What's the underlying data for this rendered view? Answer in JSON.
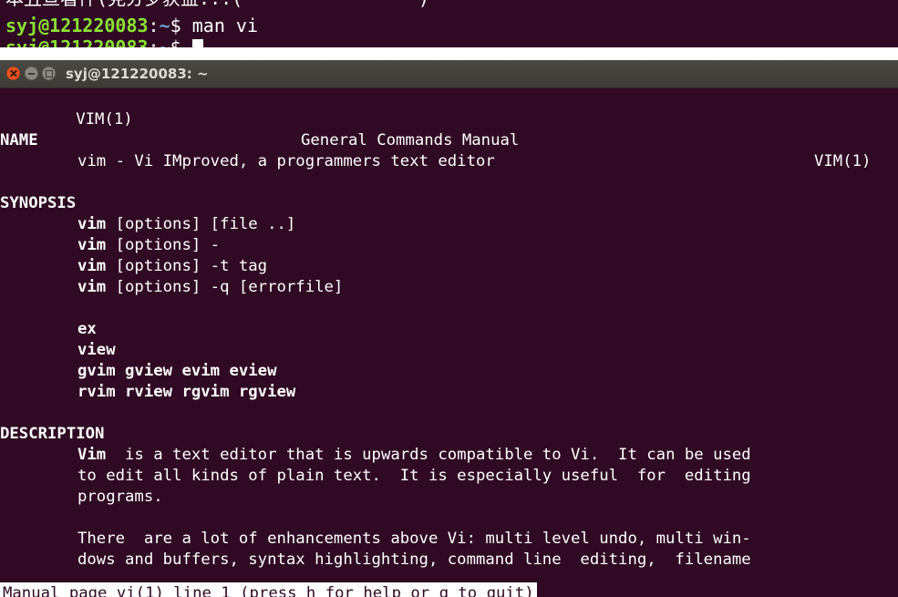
{
  "background_terminal": {
    "cropped_line": "本丑亘看件(見分岁获益...(                )",
    "prompt_user_host": "syj@121220083",
    "prompt_sep": ":",
    "prompt_path": "~",
    "prompt_symbol": "$",
    "command": "man vi",
    "next_prompt_user_host": "syj@121220083",
    "next_prompt_sep": ":",
    "next_prompt_path": "~",
    "next_prompt_symbol": "$"
  },
  "window": {
    "title": "syj@121220083: ~",
    "buttons": {
      "close": "close",
      "minimize": "minimize",
      "maximize": "maximize"
    }
  },
  "manpage": {
    "header_left": "VIM(1)",
    "header_center": "General Commands Manual",
    "header_right": "VIM(1)",
    "name_heading": "NAME",
    "name_text": "vim - Vi IMproved, a programmers text editor",
    "synopsis_heading": "SYNOPSIS",
    "synopsis_cmd": "vim",
    "synopsis": [
      " [options] [file ..]",
      " [options] -",
      " [options] -t tag",
      " [options] -q [errorfile]"
    ],
    "aliases": [
      "ex",
      "view",
      "gvim gview evim eview",
      "rvim rview rgvim rgview"
    ],
    "description_heading": "DESCRIPTION",
    "desc_bold": "Vim",
    "desc_line1": "  is a text editor that is upwards compatible to Vi.  It can be used",
    "desc_line2": "to edit all kinds of plain text.  It is especially useful  for  editing",
    "desc_line3": "programs.",
    "desc_line4": "There  are a lot of enhancements above Vi: multi level undo, multi win-",
    "desc_line5": "dows and buffers, syntax highlighting, command line  editing,  filename"
  },
  "status_bar": {
    "text": "Manual page vi(1) line 1 (press h for help or q to quit)"
  },
  "colors": {
    "terminal_bg": "#300a24",
    "prompt_user": "#8ae234",
    "prompt_path": "#729fcf",
    "titlebar": "#3c3b37",
    "close_button": "#e9541f"
  }
}
